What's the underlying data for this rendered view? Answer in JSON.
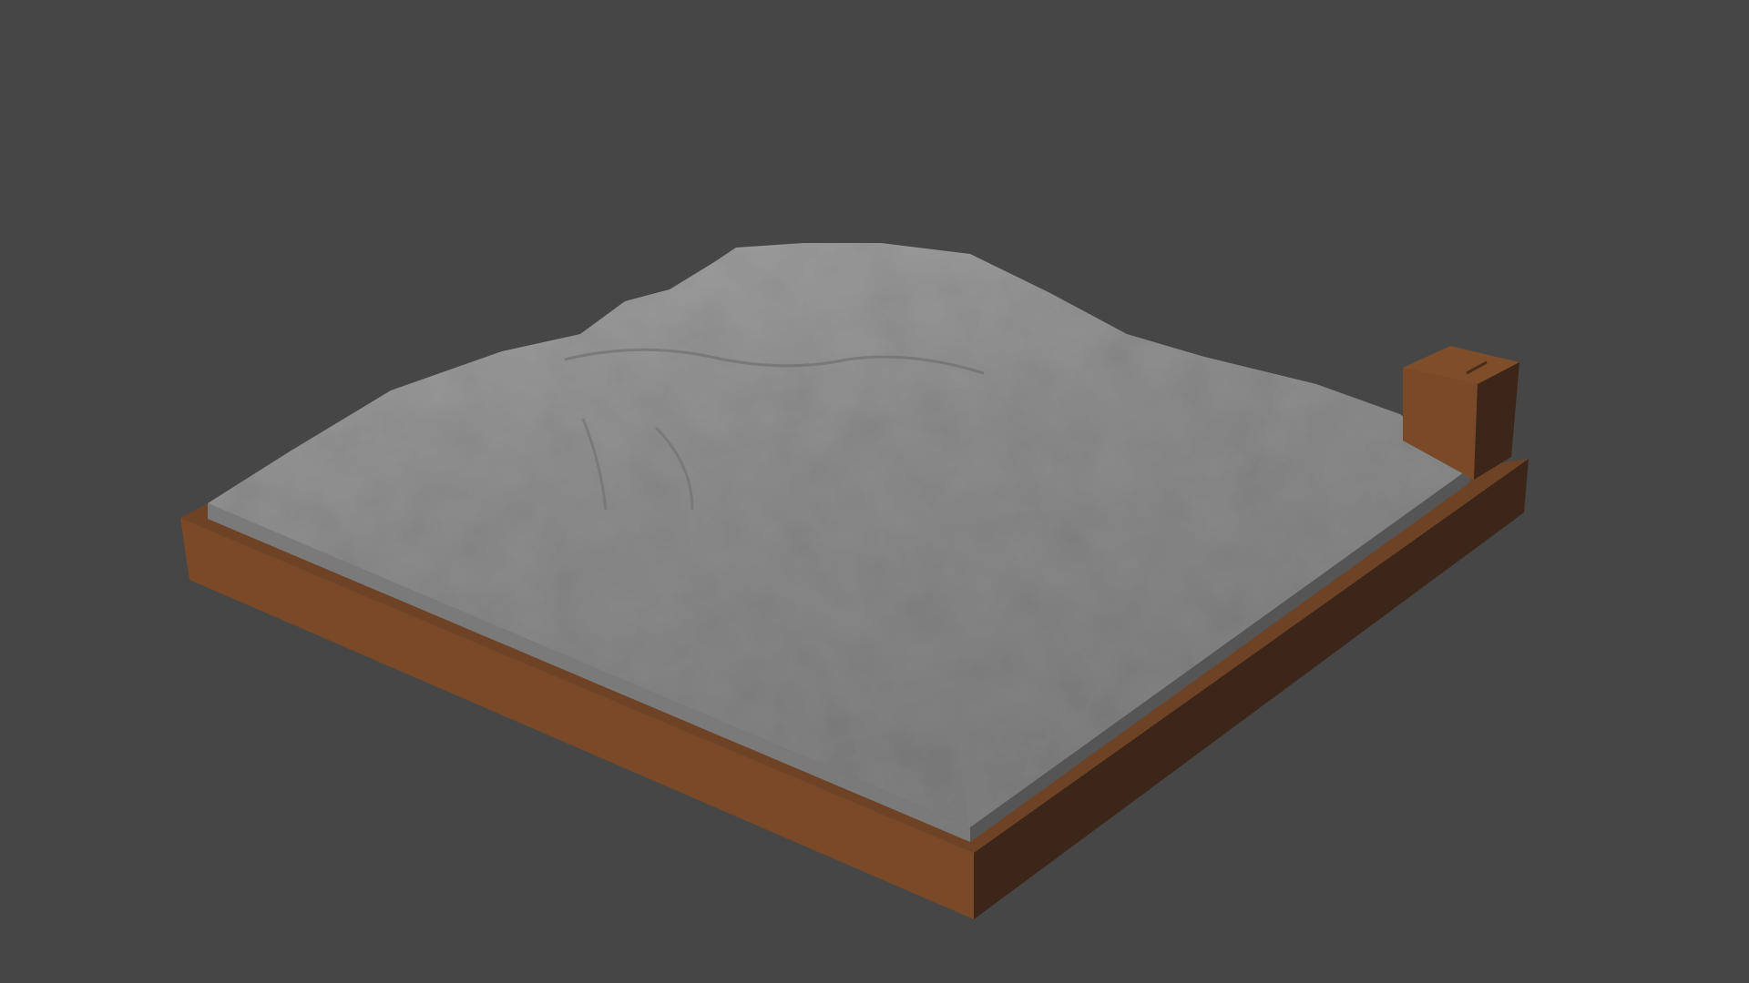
{
  "scene": {
    "background_color": "#464646",
    "wood_color": "#7a4a28",
    "wood_dark_color": "#3c2519",
    "terrain_color": "#8e8e8e",
    "terrain_shadow_color": "#6a6a6a"
  }
}
